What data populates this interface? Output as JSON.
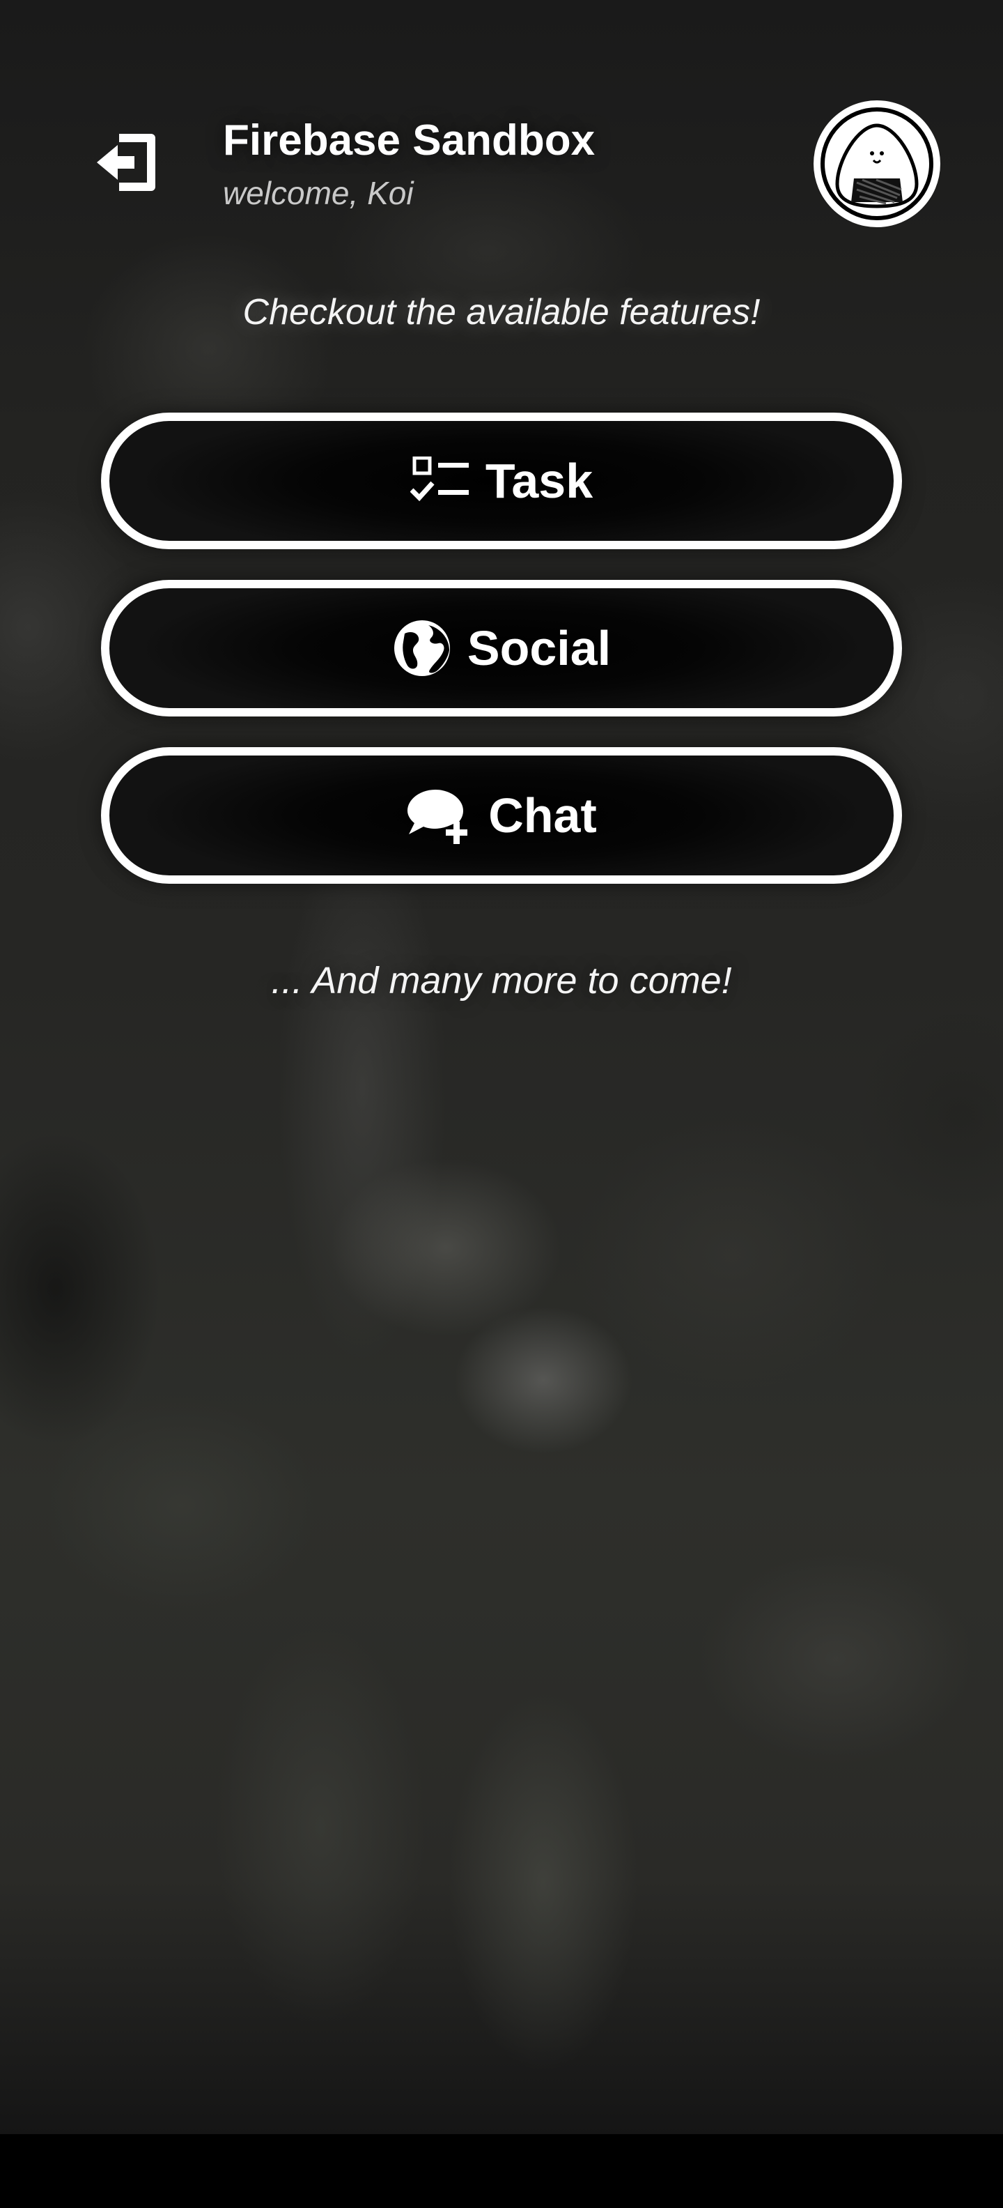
{
  "header": {
    "title": "Firebase Sandbox",
    "subtitle": "welcome, Koi"
  },
  "intro_text": "Checkout the available features!",
  "features": [
    {
      "label": "Task",
      "icon": "checklist-icon"
    },
    {
      "label": "Social",
      "icon": "globe-icon"
    },
    {
      "label": "Chat",
      "icon": "chat-add-icon"
    }
  ],
  "footer_text": "... And many more to come!",
  "icons": {
    "logout": "logout-icon",
    "avatar": "onigiri-avatar"
  },
  "colors": {
    "text": "#ffffff",
    "subtitle": "#c9c9c9",
    "button_border": "#ffffff",
    "button_fill": "#000000"
  }
}
